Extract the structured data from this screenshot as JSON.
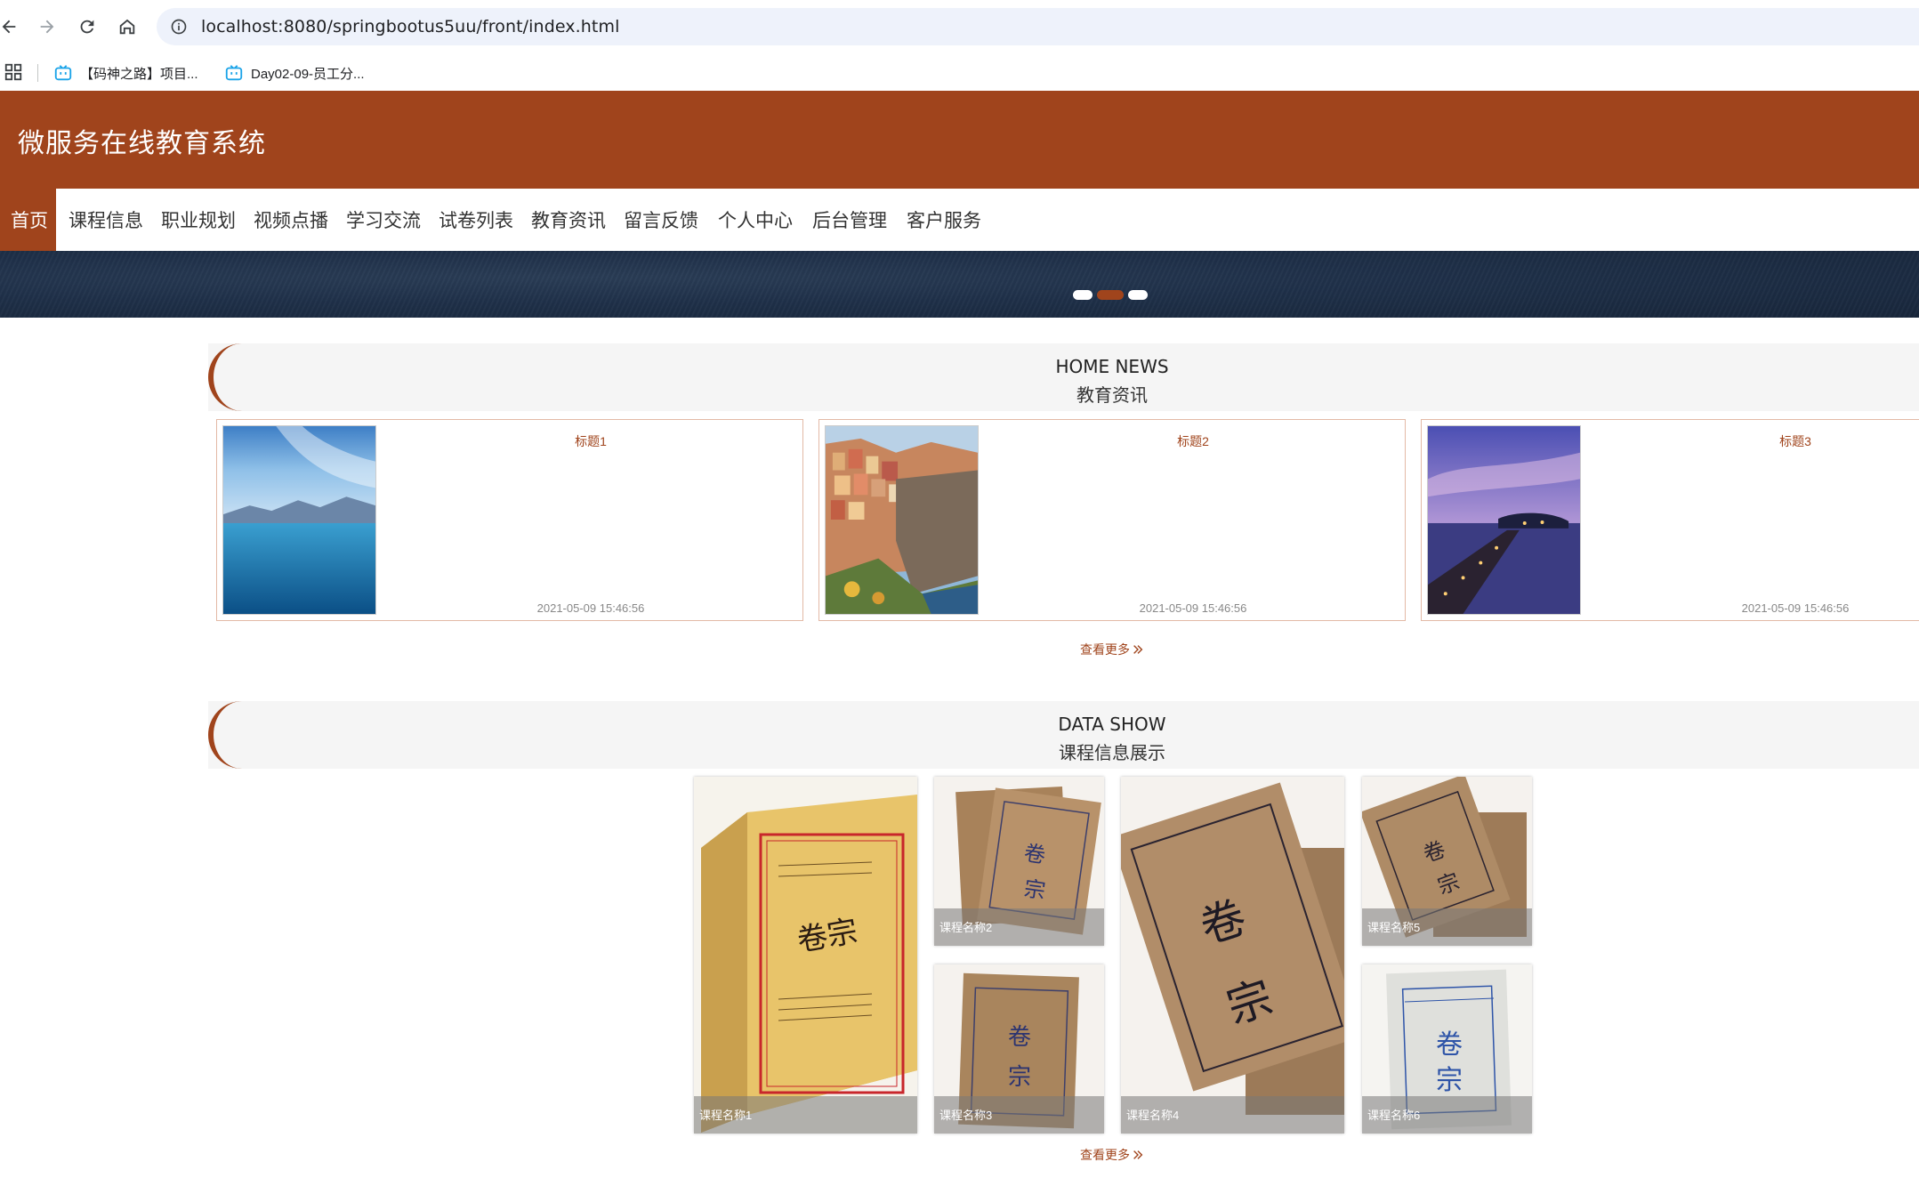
{
  "browser": {
    "url": "localhost:8080/springbootus5uu/front/index.html",
    "bookmarks": [
      {
        "label": "【码神之路】项目..."
      },
      {
        "label": "Day02-09-员工分..."
      }
    ]
  },
  "site": {
    "title": "微服务在线教育系统"
  },
  "nav": {
    "items": [
      "首页",
      "课程信息",
      "职业规划",
      "视频点播",
      "学习交流",
      "试卷列表",
      "教育资讯",
      "留言反馈",
      "个人中心",
      "后台管理",
      "客户服务"
    ],
    "active_index": 0
  },
  "news": {
    "en_title": "HOME NEWS",
    "cn_title": "教育资讯",
    "items": [
      {
        "title": "标题1",
        "time": "2021-05-09 15:46:56"
      },
      {
        "title": "标题2",
        "time": "2021-05-09 15:46:56"
      },
      {
        "title": "标题3",
        "time": "2021-05-09 15:46:56"
      }
    ],
    "more": "查看更多"
  },
  "data_show": {
    "en_title": "DATA SHOW",
    "cn_title": "课程信息展示",
    "items": [
      {
        "name": "课程名称1"
      },
      {
        "name": "课程名称2"
      },
      {
        "name": "课程名称3"
      },
      {
        "name": "课程名称4"
      },
      {
        "name": "课程名称5"
      },
      {
        "name": "课程名称6"
      }
    ],
    "more": "查看更多"
  },
  "colors": {
    "brand": "#a0441c",
    "banner": "#1f3049"
  },
  "icons": [
    "back-icon",
    "forward-icon",
    "reload-icon",
    "home-icon",
    "info-icon",
    "apps-icon",
    "bookmark-tv-icon",
    "double-chevron-right-icon"
  ]
}
